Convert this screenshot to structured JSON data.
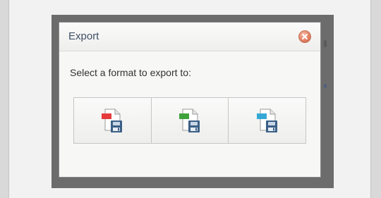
{
  "dialog": {
    "title": "Export",
    "prompt": "Select a format to export to:"
  },
  "formats": [
    {
      "icon": "pdf-file-save-icon",
      "badge_color": "#e53b3b"
    },
    {
      "icon": "excel-file-save-icon",
      "badge_color": "#3fa33b"
    },
    {
      "icon": "csv-file-save-icon",
      "badge_color": "#35a9d6"
    }
  ],
  "colors": {
    "title_text": "#3f5066",
    "close_button": "#e68b6f",
    "backdrop": "#6c6c6c"
  }
}
